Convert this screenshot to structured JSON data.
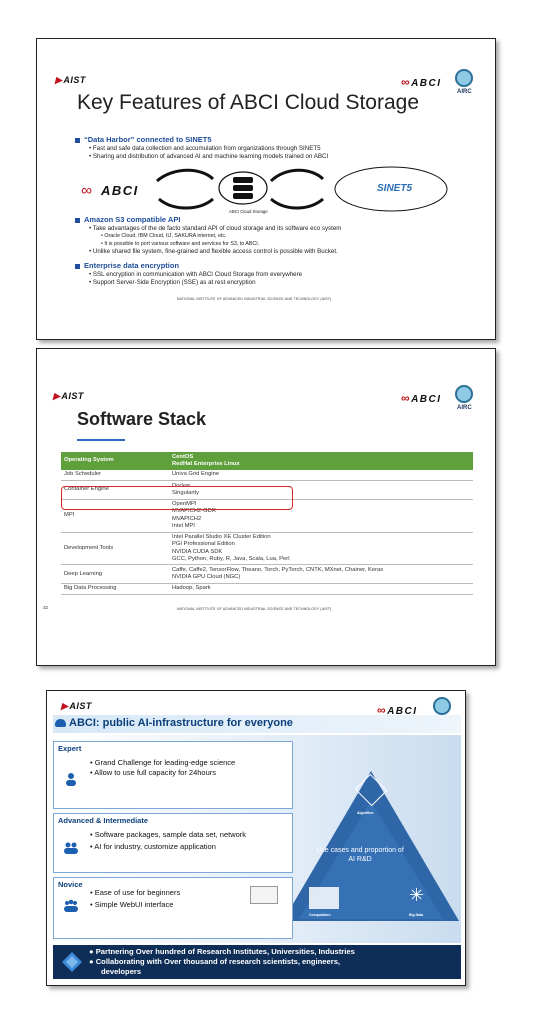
{
  "slide1": {
    "aist_logo": "AIST",
    "abci_logo": "ABCI",
    "airc_logo": "AIRC",
    "title": "Key Features of ABCI Cloud Storage",
    "sections": [
      {
        "heading": "“Data Harbor” connected to SINET5",
        "bullets": [
          "Fast and safe data collection and accumulation from organizations through SINET5",
          "Sharing and distribution of advanced AI and machine learning models trained on ABCI"
        ]
      },
      {
        "heading": "Amazon S3 compatible API",
        "bullets": [
          "Take advantages of the de facto standard API of cloud storage and its software eco system",
          "Oracle Cloud, IBM Cloud, IIJ, SAKURA internet, etc.",
          "It is possible to port various software and services for S3, to ABCI.",
          "Unlike shared file system, fine-grained and flexible access control is possible with Bucket."
        ]
      },
      {
        "heading": "Enterprise data encryption",
        "bullets": [
          "SSL encryption in communication with ABCI Cloud Storage from everywhere",
          "Support Server-Side Encryption (SSE) as at rest encryption"
        ]
      }
    ],
    "diagram": {
      "abci_label": "ABCI",
      "storage_label": "ABCI Cloud Storage",
      "sinet_label": "SINET5"
    },
    "footer": "NATIONAL INSTITUTE OF ADVANCED INDUSTRIAL SCIENCE AND TECHNOLOGY (AIST)"
  },
  "slide2": {
    "aist_logo": "AIST",
    "abci_logo": "ABCI",
    "airc_logo": "AIRC",
    "title": "Software Stack",
    "header": {
      "col1": "Operating System",
      "col2_line1": "CentOS",
      "col2_line2": "RedHat Enterprise Linux"
    },
    "rows": [
      {
        "label": "Job Scheduler",
        "values": [
          "Univa Grid Engine"
        ]
      },
      {
        "label": "Container Engine",
        "values": [
          "Docker",
          "Singularity"
        ]
      },
      {
        "label": "MPI",
        "values": [
          "OpenMPI",
          "MVAPICH2-GDR",
          "MVAPICH2",
          "Intel MPI"
        ]
      },
      {
        "label": "Development Tools",
        "values": [
          "Intel Parallel Studio XE Cluster Edition",
          "PGI Professional Edition",
          "NVIDIA CUDA SDK",
          "GCC, Python, Ruby, R, Java, Scala, Lua, Perl"
        ]
      },
      {
        "label": "Deep Learning",
        "values": [
          "Caffe, Caffe2, TensorFlow, Theano, Torch, PyTorch, CNTK, MXnet, Chainer, Keras",
          "NVIDIA GPU Cloud (NGC)"
        ]
      },
      {
        "label": "Big Data Processing",
        "values": [
          "Hadoop, Spark"
        ]
      }
    ],
    "page_number": "32",
    "footer": "NATIONAL INSTITUTE OF ADVANCED INDUSTRIAL SCIENCE AND TECHNOLOGY (AIST)"
  },
  "slide3": {
    "aist_logo": "AIST",
    "abci_logo": "ABCI",
    "title": "ABCI: public AI-infrastructure for everyone",
    "bands": [
      {
        "label": "Expert",
        "items": [
          "Grand Challenge for leading-edge science",
          "Allow to use full capacity for 24hours"
        ]
      },
      {
        "label": "Advanced & Intermediate",
        "items": [
          "Software packages, sample data set, network",
          "AI for industry, customize application"
        ]
      },
      {
        "label": "Novice",
        "items": [
          "Ease of use for beginners",
          "Simple WebUI interface"
        ]
      }
    ],
    "pyramid": {
      "text": "Use cases and proportion of AI R&D",
      "top_label": "Algorithm",
      "left_label": "Computation",
      "right_label": "Big Data"
    },
    "bottom": [
      "Partnering Over hundred of Research Institutes, Universities, Industries",
      "Collaborating with Over thousand of research scientists, engineers,",
      "developers"
    ]
  }
}
